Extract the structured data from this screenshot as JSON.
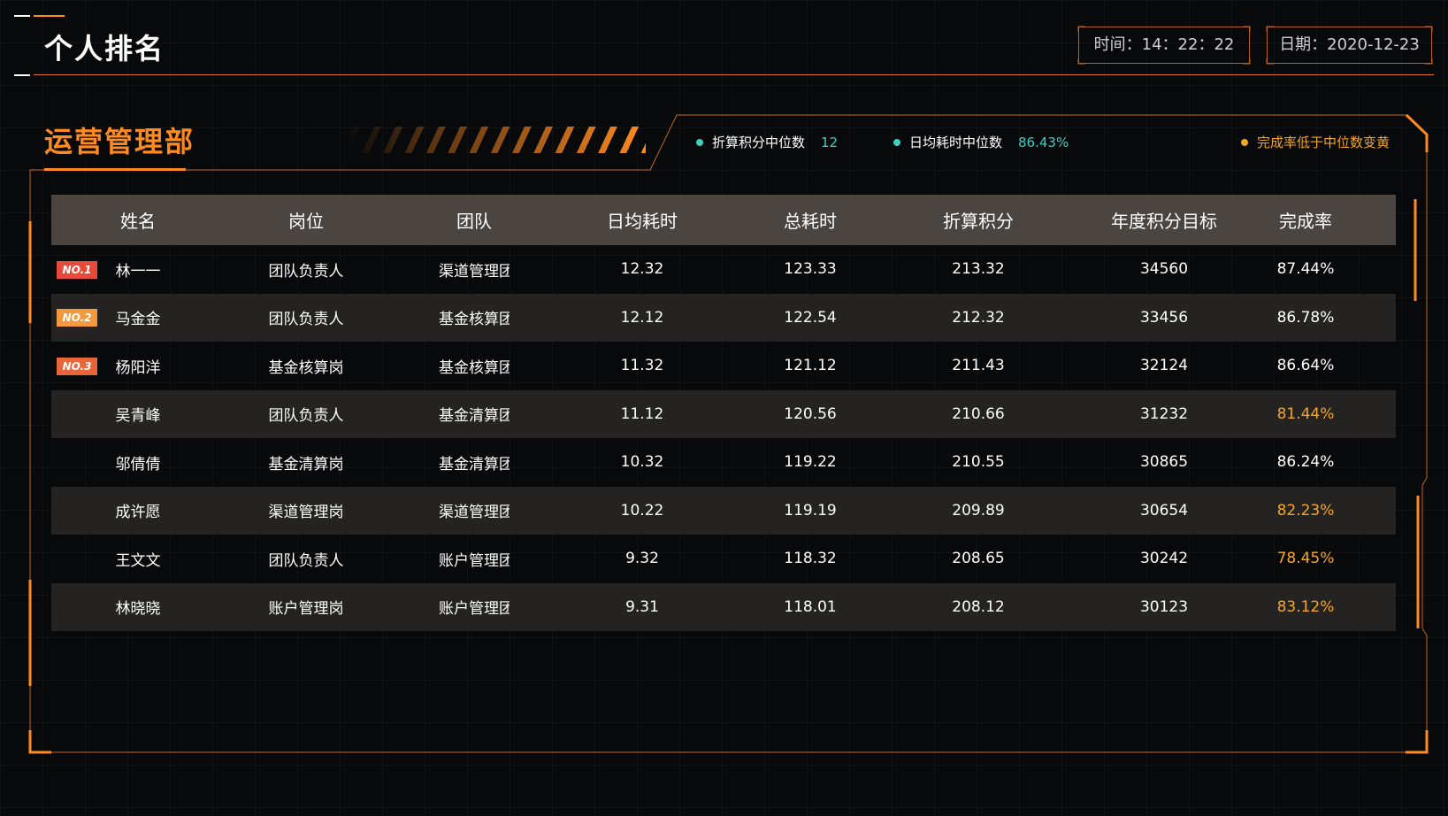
{
  "header": {
    "title": "个人排名",
    "time_label": "时间：14：22：22",
    "date_label": "日期：2020-12-23"
  },
  "section": {
    "title": "运营管理部",
    "legend": [
      {
        "label": "折算积分中位数",
        "value": "12",
        "color": "#3ecfc0"
      },
      {
        "label": "日均耗时中位数",
        "value": "86.43%",
        "color": "#3ecfc0"
      },
      {
        "label": "完成率低于中位数变黄",
        "value": "",
        "color": "#f5a623"
      }
    ]
  },
  "colors": {
    "accent": "#ff8a1f",
    "highlight": "#f5a623",
    "badge1": "#e84a3a",
    "badge2": "#f29a3d",
    "badge3": "#e8663a"
  },
  "table": {
    "columns": [
      "姓名",
      "岗位",
      "团队",
      "日均耗时",
      "总耗时",
      "折算积分",
      "年度积分目标",
      "完成率"
    ],
    "rows": [
      {
        "rank": "NO.1",
        "name": "林一一",
        "position": "团队负责人",
        "team": "渠道管理团队",
        "avg": "12.32",
        "total": "123.33",
        "points": "213.32",
        "goal": "34560",
        "rate": "87.44%",
        "below": false
      },
      {
        "rank": "NO.2",
        "name": "马金金",
        "position": "团队负责人",
        "team": "基金核算团队",
        "avg": "12.12",
        "total": "122.54",
        "points": "212.32",
        "goal": "33456",
        "rate": "86.78%",
        "below": false
      },
      {
        "rank": "NO.3",
        "name": "杨阳洋",
        "position": "基金核算岗",
        "team": "基金核算团队",
        "avg": "11.32",
        "total": "121.12",
        "points": "211.43",
        "goal": "32124",
        "rate": "86.64%",
        "below": false
      },
      {
        "rank": "",
        "name": "吴青峰",
        "position": "团队负责人",
        "team": "基金清算团队",
        "avg": "11.12",
        "total": "120.56",
        "points": "210.66",
        "goal": "31232",
        "rate": "81.44%",
        "below": true
      },
      {
        "rank": "",
        "name": "邬倩倩",
        "position": "基金清算岗",
        "team": "基金清算团队",
        "avg": "10.32",
        "total": "119.22",
        "points": "210.55",
        "goal": "30865",
        "rate": "86.24%",
        "below": false
      },
      {
        "rank": "",
        "name": "成许愿",
        "position": "渠道管理岗",
        "team": "渠道管理团队",
        "avg": "10.22",
        "total": "119.19",
        "points": "209.89",
        "goal": "30654",
        "rate": "82.23%",
        "below": true
      },
      {
        "rank": "",
        "name": "王文文",
        "position": "团队负责人",
        "team": "账户管理团队",
        "avg": "9.32",
        "total": "118.32",
        "points": "208.65",
        "goal": "30242",
        "rate": "78.45%",
        "below": true
      },
      {
        "rank": "",
        "name": "林晓晓",
        "position": "账户管理岗",
        "team": "账户管理团队",
        "avg": "9.31",
        "total": "118.01",
        "points": "208.12",
        "goal": "30123",
        "rate": "83.12%",
        "below": true
      }
    ]
  }
}
